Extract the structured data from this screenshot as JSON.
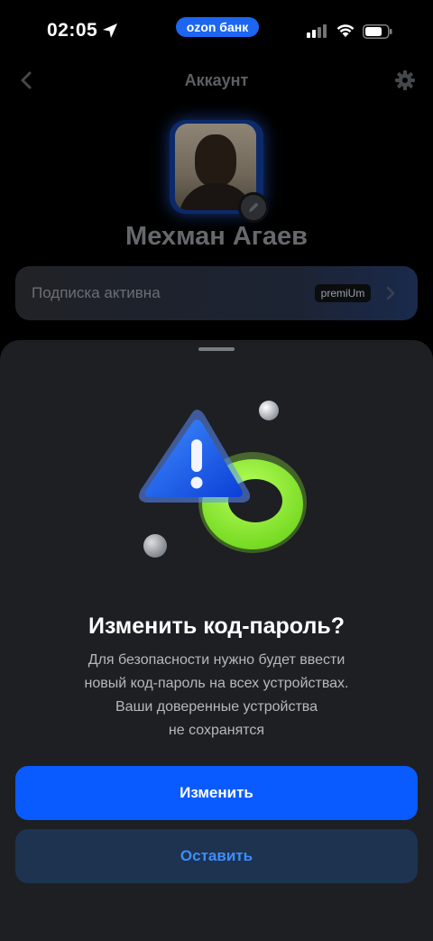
{
  "status_bar": {
    "time": "02:05",
    "bank_pill": "ozon банк"
  },
  "header": {
    "title": "Аккаунт"
  },
  "profile": {
    "name": "Мехман Агаев"
  },
  "subscription": {
    "label": "Подписка активна",
    "badge": "premiUm"
  },
  "sheet": {
    "title": "Изменить код-пароль?",
    "body_lines": [
      "Для безопасности нужно будет ввести",
      "новый код-пароль на всех устройствах.",
      "Ваши доверенные устройства",
      "не сохранятся"
    ],
    "primary_button": "Изменить",
    "secondary_button": "Оставить"
  },
  "colors": {
    "accent": "#0a5bff",
    "secondary_button_bg": "#1d3350",
    "secondary_button_text": "#3d8dff",
    "sheet_bg": "#1d1f23"
  }
}
